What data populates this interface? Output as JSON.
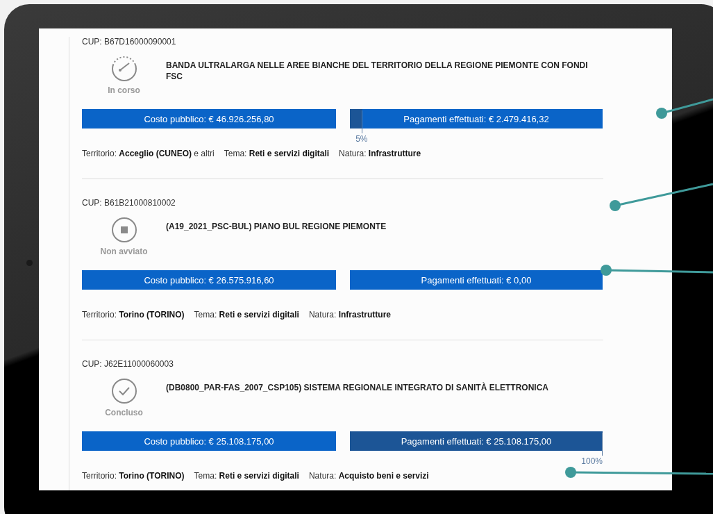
{
  "projects": [
    {
      "cup": "CUP: B67D16000090001",
      "status": {
        "kind": "in_progress",
        "label": "In corso"
      },
      "title": "BANDA ULTRALARGA NELLE AREE BIANCHE DEL TERRITORIO DELLA REGIONE PIEMONTE CON FONDI FSC",
      "cost": "Costo pubblico: € 46.926.256,80",
      "payment": {
        "label": "Pagamenti effettuati: € 2.479.416,32",
        "level": 0.05,
        "percent": "5%"
      },
      "meta": [
        "Territorio: **Acceglio (CUNEO)** e altri",
        "Tema: **Reti e servizi digitali**",
        "Natura: **Infrastrutture**"
      ]
    },
    {
      "cup": "CUP: B61B21000810002",
      "status": {
        "kind": "not_started",
        "label": "Non avviato"
      },
      "title": "(A19_2021_PSC-BUL) PIANO BUL REGIONE PIEMONTE",
      "cost": "Costo pubblico: € 26.575.916,60",
      "payment": {
        "label": "Pagamenti effettuati: € 0,00"
      },
      "meta": [
        "Territorio: **Torino (TORINO)**",
        "Tema: **Reti e servizi digitali**",
        "Natura: **Infrastrutture**"
      ]
    },
    {
      "cup": "CUP: J62E11000060003",
      "status": {
        "kind": "done",
        "label": "Concluso"
      },
      "title": "(DB0800_PAR-FAS_2007_CSP105) SISTEMA REGIONALE INTEGRATO DI SANITÀ  ELETTRONICA",
      "cost": "Costo pubblico: € 25.108.175,00",
      "payment": {
        "label": "Pagamenti effettuati: € 25.108.175,00",
        "level": 1,
        "percent": "100%"
      },
      "meta": [
        "Territorio: **Torino (TORINO)**",
        "Tema: **Reti e servizi digitali**",
        "Natura: **Acquisto beni e servizi**"
      ]
    }
  ]
}
